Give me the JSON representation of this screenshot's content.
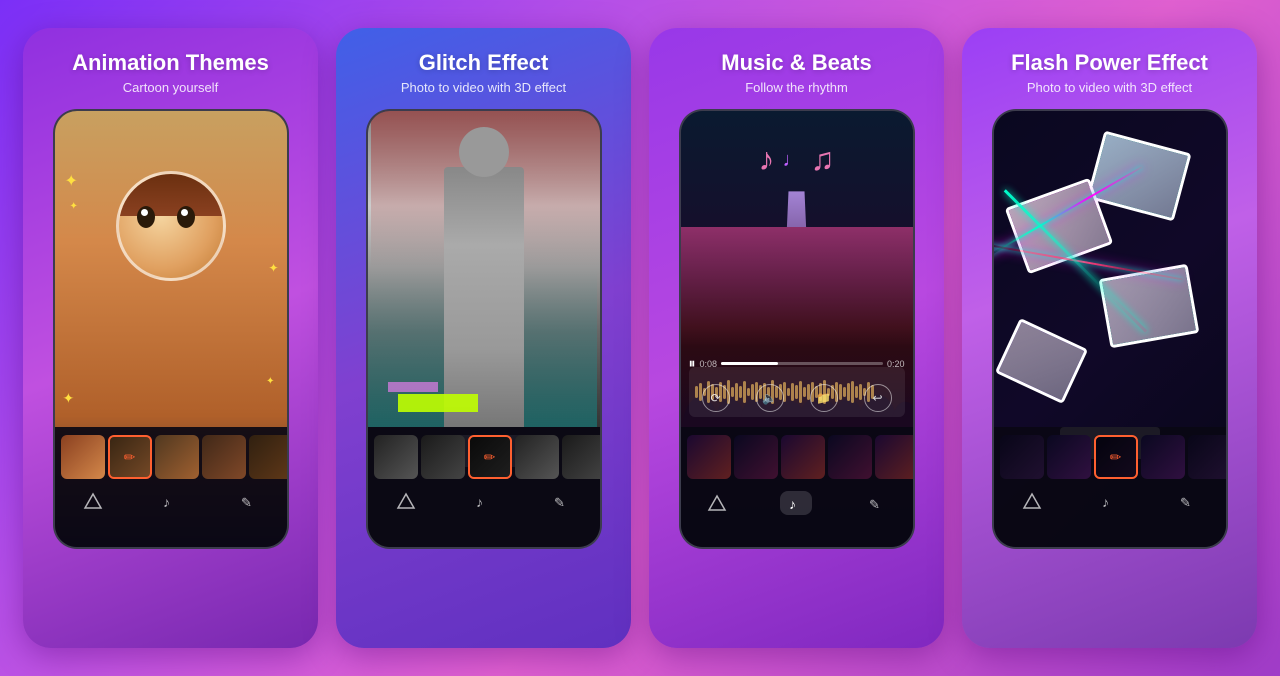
{
  "cards": [
    {
      "id": "animation-themes",
      "title": "Animation Themes",
      "subtitle": "Cartoon yourself",
      "accent": "#a040e0"
    },
    {
      "id": "glitch-effect",
      "title": "Glitch Effect",
      "subtitle": "Photo to video with 3D effect",
      "accent": "#9030e0"
    },
    {
      "id": "music-beats",
      "title": "Music & Beats",
      "subtitle": "Follow the rhythm",
      "accent": "#4060e8"
    },
    {
      "id": "flash-power-effect",
      "title": "Flash Power Effect",
      "subtitle": "Photo to video with 3D effect",
      "accent": "#9838e8"
    }
  ],
  "icons": {
    "pencil": "✏",
    "music_note": "♪",
    "music_note2": "♫",
    "triangle": "▲",
    "note_icon": "𝄞",
    "play": "▶",
    "pause": "⏸"
  },
  "time": {
    "start": "0:08",
    "end": "0:20"
  }
}
